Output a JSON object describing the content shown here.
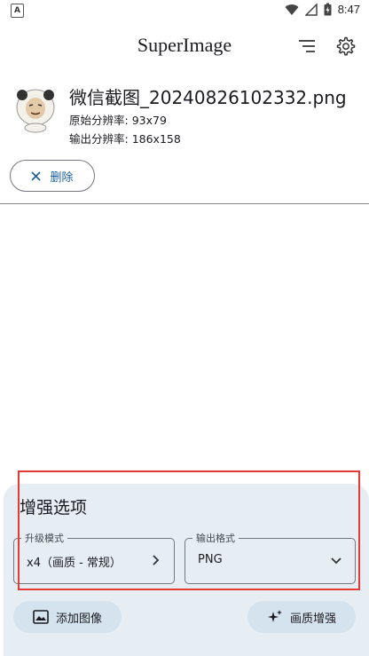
{
  "status_bar": {
    "left_icon_letter": "A",
    "time": "8:47"
  },
  "header": {
    "title": "SuperImage"
  },
  "file": {
    "name": "微信截图_20240826102332.png",
    "original_resolution_label": "原始分辨率:",
    "original_resolution": "93x79",
    "output_resolution_label": "输出分辨率:",
    "output_resolution": "186x158",
    "delete_label": "删除"
  },
  "options": {
    "title": "增强选项",
    "upscale_mode": {
      "label": "升级模式",
      "value": "x4（画质 - 常规）"
    },
    "output_format": {
      "label": "输出格式",
      "value": "PNG"
    },
    "add_image_label": "添加图像",
    "enhance_label": "画质增强"
  },
  "colors": {
    "accent": "#1b5e9c",
    "panel_bg": "#e6eef4",
    "button_bg": "#d5e3ef",
    "highlight": "#e53935"
  }
}
